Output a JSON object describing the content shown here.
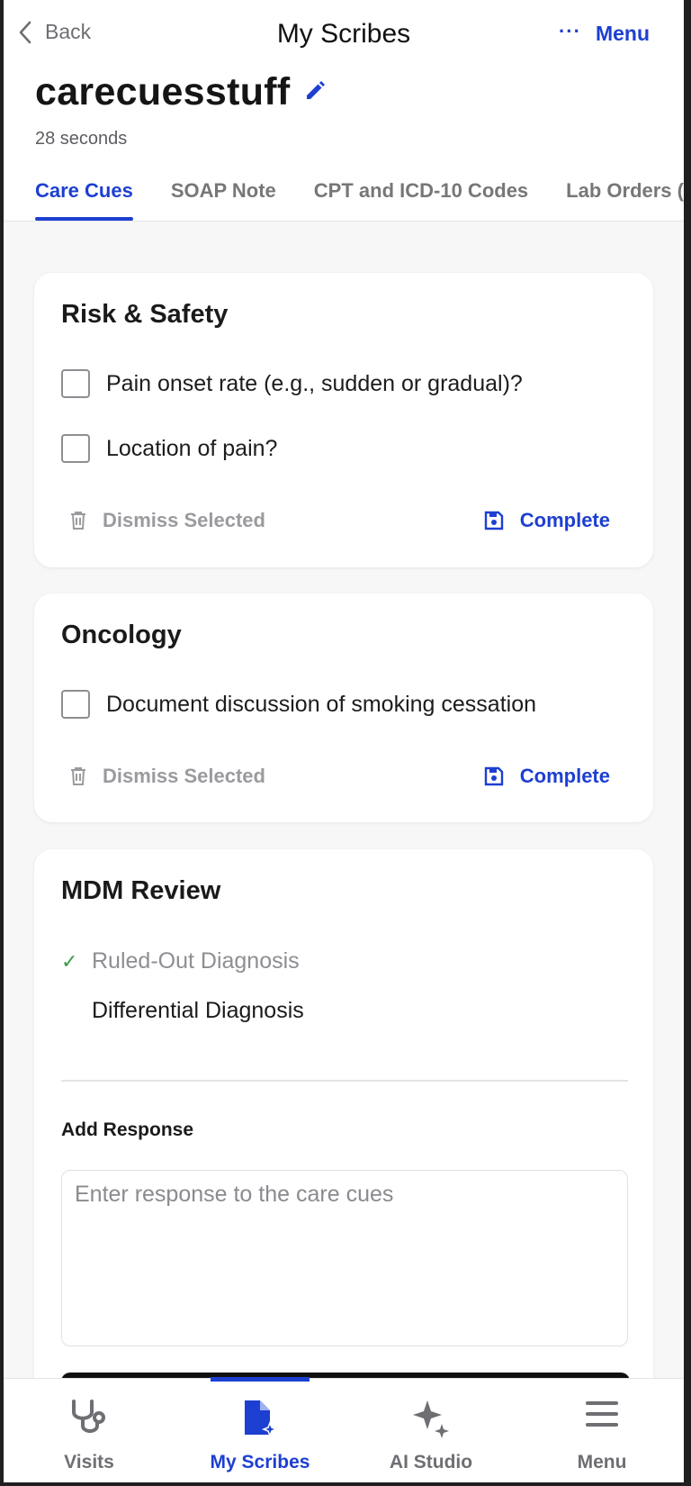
{
  "topbar": {
    "back_label": "Back",
    "title": "My Scribes",
    "menu_label": "Menu"
  },
  "scribe": {
    "title": "carecuesstuff",
    "duration": "28 seconds"
  },
  "tabs": [
    {
      "label": "Care Cues",
      "active": true
    },
    {
      "label": "SOAP Note",
      "active": false
    },
    {
      "label": "CPT and ICD-10 Codes",
      "active": false
    },
    {
      "label": "Lab Orders (A",
      "active": false
    }
  ],
  "cards": {
    "risk": {
      "title": "Risk & Safety",
      "cues": [
        "Pain onset rate (e.g., sudden or gradual)?",
        "Location of pain?"
      ],
      "dismiss_label": "Dismiss Selected",
      "complete_label": "Complete"
    },
    "oncology": {
      "title": "Oncology",
      "cues": [
        "Document discussion of smoking cessation"
      ],
      "dismiss_label": "Dismiss Selected",
      "complete_label": "Complete"
    },
    "mdm": {
      "title": "MDM Review",
      "items": [
        {
          "label": "Ruled-Out Diagnosis",
          "done": true
        },
        {
          "label": "Differential Diagnosis",
          "done": false
        }
      ],
      "response_label": "Add Response",
      "response_placeholder": "Enter response to the care cues"
    }
  },
  "bottom_nav": [
    {
      "label": "Visits",
      "icon": "stethoscope-icon",
      "active": false
    },
    {
      "label": "My Scribes",
      "icon": "scribe-document-icon",
      "active": true
    },
    {
      "label": "AI Studio",
      "icon": "sparkle-icon",
      "active": false
    },
    {
      "label": "Menu",
      "icon": "hamburger-icon",
      "active": false
    }
  ],
  "colors": {
    "accent": "#1d3fd1",
    "check_green": "#3a9a46",
    "muted": "#9a9a9f"
  }
}
